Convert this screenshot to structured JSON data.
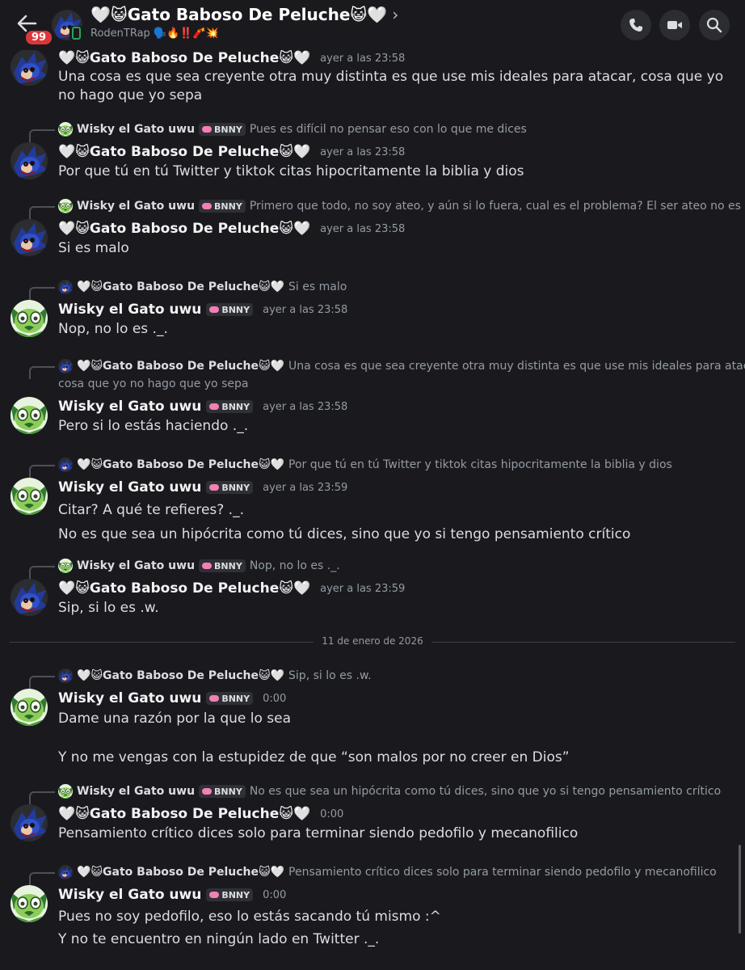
{
  "header": {
    "back_badge": "99",
    "title": "🤍😺Gato Baboso De Peluche😺🤍",
    "chevron": "›",
    "subtitle": "RodenTRap 🗣️🔥‼️🧨💥",
    "icons": [
      "back-arrow-icon",
      "phone-icon",
      "video-icon",
      "search-icon"
    ],
    "colors": {
      "background": "#1a1a1e",
      "badge": "#da373c"
    }
  },
  "messages": [
    {
      "author": "🤍😺Gato Baboso De Peluche😺🤍",
      "time": "ayer a las 23:58",
      "lines": [
        "Una cosa es que sea creyente otra muy distinta es que use mis ideales para atacar, cosa que yo no hago que yo sepa"
      ]
    },
    {
      "reply_author": "Wisky el Gato uwu",
      "reply_tag": "BNNY",
      "reply_text": "Pues es difícil no pensar eso con lo que me dices",
      "author": "🤍😺Gato Baboso De Peluche😺🤍",
      "time": "ayer a las 23:58",
      "lines": [
        "Por que tú en tú Twitter y tiktok citas hipocritamente la biblia y dios"
      ]
    },
    {
      "reply_author": "Wisky el Gato uwu",
      "reply_tag": "BNNY",
      "reply_text": "Primero que todo, no soy ateo, y aún si lo fuera, cual es el problema? El ser ateo no es malo :^",
      "author": "🤍😺Gato Baboso De Peluche😺🤍",
      "time": "ayer a las 23:58",
      "lines": [
        "Si es malo"
      ]
    },
    {
      "reply_author": "🤍😺Gato Baboso De Peluche😺🤍",
      "reply_text": "Si es malo",
      "author": "Wisky el Gato uwu",
      "tag": "BNNY",
      "time": "ayer a las 23:58",
      "lines": [
        "Nop, no lo es ._."
      ]
    },
    {
      "reply_author": "🤍😺Gato Baboso De Peluche😺🤍",
      "reply_text": "Una cosa es que sea creyente otra muy distinta es que use mis ideales para atacar,",
      "reply_text2": "cosa que yo no hago que yo sepa",
      "author": "Wisky el Gato uwu",
      "tag": "BNNY",
      "time": "ayer a las 23:58",
      "lines": [
        "Pero si lo estás haciendo ._."
      ]
    },
    {
      "reply_author": "🤍😺Gato Baboso De Peluche😺🤍",
      "reply_text": "Por que tú en tú Twitter y tiktok citas hipocritamente la biblia y dios",
      "author": "Wisky el Gato uwu",
      "tag": "BNNY",
      "time": "ayer a las 23:59",
      "lines": [
        "Citar? A qué te refieres? ._.",
        "No es que sea un hipócrita como tú dices, sino que yo si tengo pensamiento crítico"
      ]
    },
    {
      "reply_author": "Wisky el Gato uwu",
      "reply_tag": "BNNY",
      "reply_text": "Nop, no lo es ._.",
      "author": "🤍😺Gato Baboso De Peluche😺🤍",
      "time": "ayer a las 23:59",
      "lines": [
        "Sip, si lo es .w."
      ]
    },
    {
      "reply_author": "🤍😺Gato Baboso De Peluche😺🤍",
      "reply_text": "Sip, si lo es .w.",
      "author": "Wisky el Gato uwu",
      "tag": "BNNY",
      "time": "0:00",
      "lines": [
        "Dame una razón por la que lo sea",
        "",
        "Y no me vengas con la estupidez de que “son malos por no creer en Dios”"
      ]
    },
    {
      "reply_author": "Wisky el Gato uwu",
      "reply_tag": "BNNY",
      "reply_text": "No es que sea un hipócrita como tú dices, sino que yo si tengo pensamiento crítico",
      "author": "🤍😺Gato Baboso De Peluche😺🤍",
      "time": "0:00",
      "lines": [
        "Pensamiento crítico dices solo para terminar siendo pedofilo y mecanofilico"
      ]
    },
    {
      "reply_author": "🤍😺Gato Baboso De Peluche😺🤍",
      "reply_text": "Pensamiento crítico dices solo para terminar siendo pedofilo y mecanofilico",
      "author": "Wisky el Gato uwu",
      "tag": "BNNY",
      "time": "0:00",
      "lines": [
        "Pues no soy pedofilo, eso lo estás sacando tú mismo :^",
        "Y no te encuentro en ningún lado en Twitter ._."
      ]
    }
  ],
  "date_divider": "11 de enero de 2026"
}
